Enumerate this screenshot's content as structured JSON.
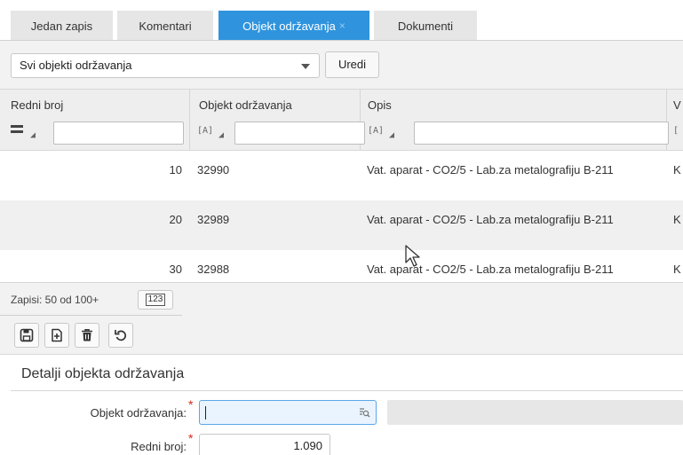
{
  "tabs": [
    {
      "label": "Jedan zapis",
      "active": false
    },
    {
      "label": "Komentari",
      "active": false
    },
    {
      "label": "Objekt održavanja",
      "active": true,
      "closable": true
    },
    {
      "label": "Dokumenti",
      "active": false
    }
  ],
  "tab_close_glyph": "×",
  "filter_bar": {
    "selected_view": "Svi objekti održavanja",
    "edit_button": "Uredi"
  },
  "grid": {
    "columns": [
      {
        "title": "Redni broj",
        "filter_icon": "equals-icon"
      },
      {
        "title": "Objekt održavanja",
        "filter_icon": "text-filter-icon"
      },
      {
        "title": "Opis",
        "filter_icon": "text-filter-icon"
      },
      {
        "title": "V",
        "filter_icon": "text-filter-icon"
      }
    ],
    "filter_icon_text": "[A]",
    "rows": [
      {
        "redni_broj": "10",
        "objekt": "32990",
        "opis": "Vat. aparat - CO2/5 - Lab.za metalografiju B-211",
        "v": "K"
      },
      {
        "redni_broj": "20",
        "objekt": "32989",
        "opis": "Vat. aparat - CO2/5 - Lab.za metalografiju B-211",
        "v": "K"
      },
      {
        "redni_broj": "30",
        "objekt": "32988",
        "opis": "Vat. aparat - CO2/5 - Lab.za metalografiju B-211",
        "v": "K"
      }
    ]
  },
  "footer": {
    "record_count": "Zapisi: 50 od 100+",
    "count_button": "123",
    "actions": [
      "save-icon",
      "add-icon",
      "delete-icon",
      "undo-icon"
    ]
  },
  "details": {
    "title": "Detalji objekta održavanja",
    "fields": [
      {
        "label": "Objekt održavanja:",
        "value": "",
        "required": true
      },
      {
        "label": "Redni broj:",
        "value": "1.090",
        "required": true
      }
    ],
    "required_marker": "*"
  },
  "colors": {
    "accent": "#2f94dd",
    "required": "#d9261c"
  }
}
